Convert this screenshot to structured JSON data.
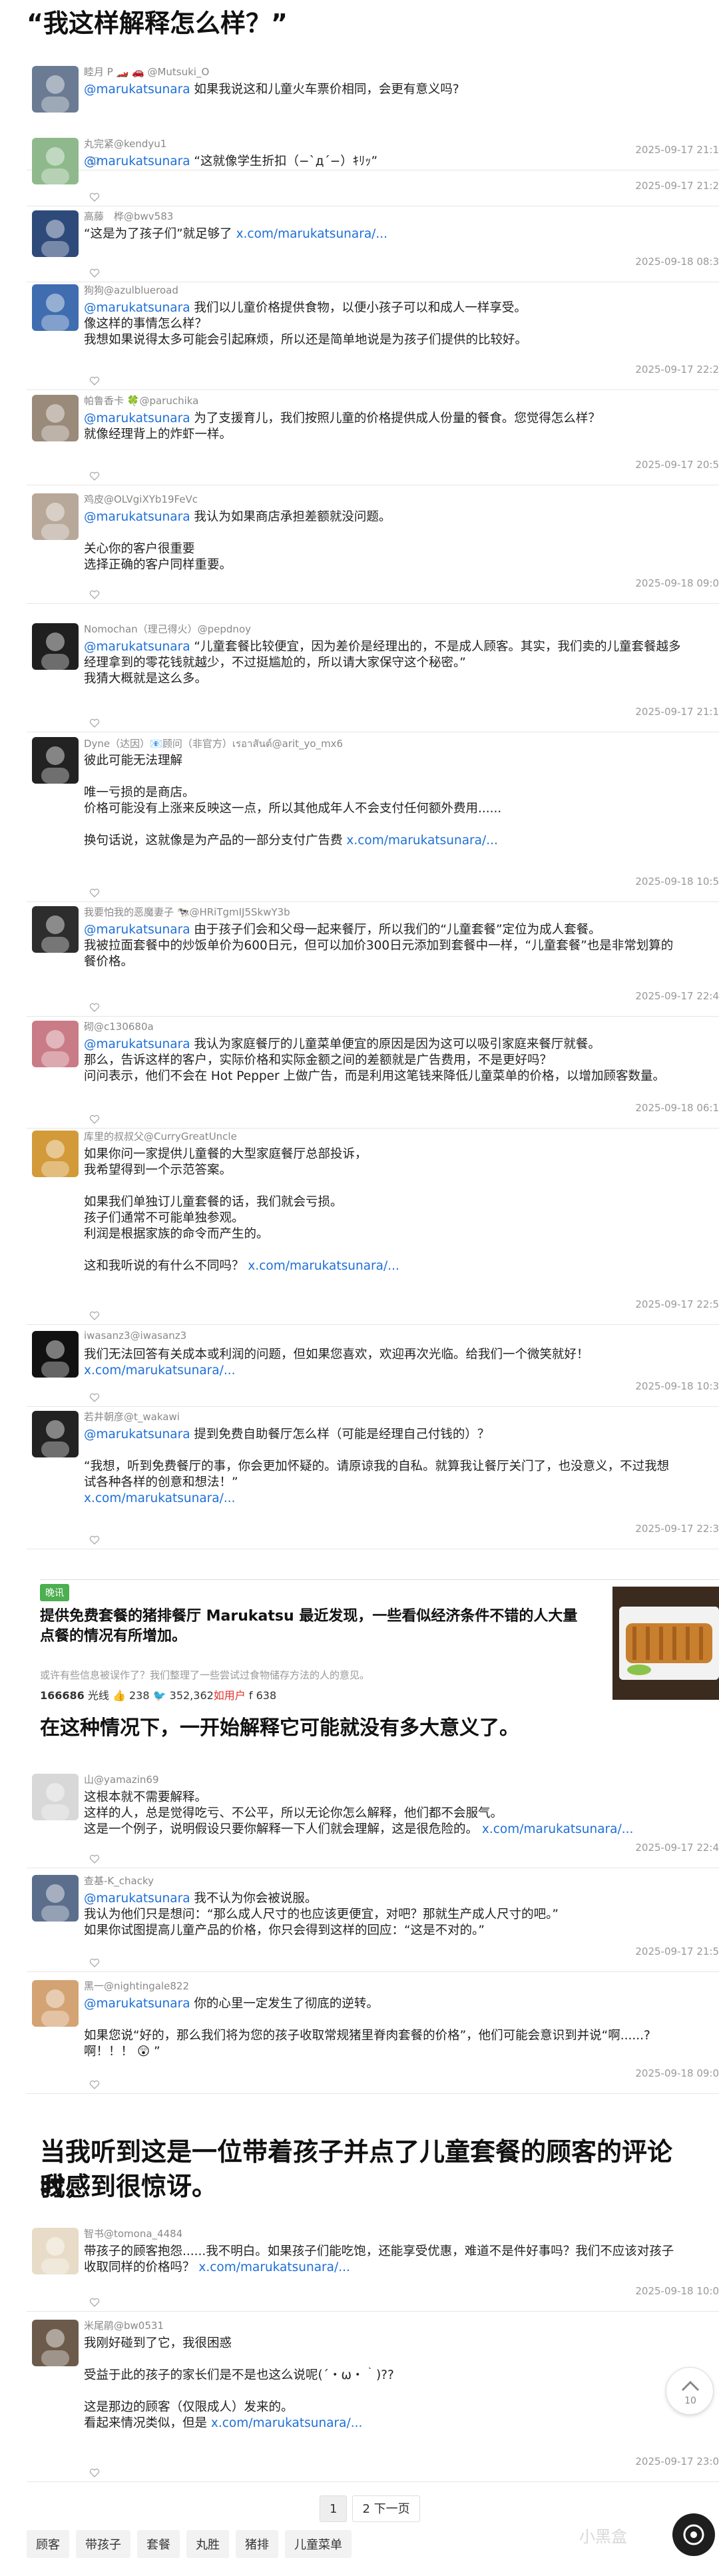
{
  "headline": "“我这样解释怎么样？”",
  "tweets": [
    {
      "handle": "睦月 P 🏎️ 🚗 @Mutsuki_O",
      "lines": [
        [
          "@marukatsunara",
          " 如果我说这和儿童火车票价相同，会更有意义吗?"
        ]
      ],
      "date": "2025-09-17 21:1"
    },
    {
      "handle": "丸完紧@kendyu1",
      "lines": [
        [
          "@marukatsunara",
          " “这就像学生折扣（−`д´−）ｷﾘｯ”"
        ]
      ],
      "date": "2025-09-17 21:2"
    },
    {
      "handle": "高藤　桦@bwv583",
      "lines": [
        [
          "",
          "“这是为了孩子们”就足够了 ",
          "x.com/marukatsunara/..."
        ]
      ],
      "date": "2025-09-18 08:3"
    },
    {
      "handle": "狗狗@azulblueroad",
      "lines": [
        [
          "@marukatsunara",
          " 我们以儿童价格提供食物，以便小孩子可以和成人一样享受。"
        ],
        [
          "",
          "像这样的事情怎么样？"
        ],
        [
          "",
          "我想如果说得太多可能会引起麻烦，所以还是简单地说是为孩子们提供的比较好。"
        ]
      ],
      "date": "2025-09-17 22:2"
    },
    {
      "handle": "帕鲁香卡 🍀@paruchika",
      "lines": [
        [
          "@marukatsunara",
          " 为了支援育儿，我们按照儿童的价格提供成人份量的餐食。您觉得怎么样？"
        ],
        [
          "",
          "就像经理背上的炸虾一样。"
        ]
      ],
      "date": "2025-09-17 20:5"
    },
    {
      "handle": "鸡皮@OLVgiXYb19FeVc",
      "lines": [
        [
          "@marukatsunara",
          " 我认为如果商店承担差额就没问题。"
        ],
        [
          "",
          ""
        ],
        [
          "",
          "关心你的客户很重要"
        ],
        [
          "",
          "选择正确的客户同样重要。"
        ]
      ],
      "date": "2025-09-18 09:0"
    },
    {
      "handle": "Nomochan（理己得火）@pepdnoy",
      "lines": [
        [
          "@marukatsunara",
          " “儿童套餐比较便宜，因为差价是经理出的，不是成人顾客。其实，我们卖的儿童套餐越多"
        ],
        [
          "",
          "经理拿到的零花钱就越少，不过挺尴尬的，所以请大家保守这个秘密。”"
        ],
        [
          "",
          "我猜大概就是这么多。"
        ]
      ],
      "date": "2025-09-17 21:1"
    },
    {
      "handle": "Dyne（达因）📧顾问（非官方）เรอาสันต์@arit_yo_mx6",
      "lines": [
        [
          "",
          "彼此可能无法理解"
        ],
        [
          "",
          ""
        ],
        [
          "",
          "唯一亏损的是商店。"
        ],
        [
          "",
          "价格可能没有上涨来反映这一点，所以其他成年人不会支付任何额外费用......"
        ],
        [
          "",
          ""
        ],
        [
          "",
          "换句话说，这就像是为产品的一部分支付广告费 ",
          "x.com/marukatsunara/..."
        ]
      ],
      "date": "2025-09-18 10:5"
    },
    {
      "handle": "我要怕我的恶魔妻子 🐄@HRiTgmIJ5SkwY3b",
      "lines": [
        [
          "@marukatsunara",
          " 由于孩子们会和父母一起来餐厅，所以我们的“儿童套餐”定位为成人套餐。"
        ],
        [
          "",
          "我被拉面套餐中的炒饭单价为600日元，但可以加价300日元添加到套餐中一样，“儿童套餐”也是非常划算的"
        ],
        [
          "",
          "餐价格。"
        ]
      ],
      "date": "2025-09-17 22:4"
    },
    {
      "handle": "砌@c130680a",
      "lines": [
        [
          "@marukatsunara",
          " 我认为家庭餐厅的儿童菜单便宜的原因是因为这可以吸引家庭来餐厅就餐。"
        ],
        [
          "",
          "那么，告诉这样的客户，实际价格和实际金额之间的差额就是广告费用，不是更好吗？"
        ],
        [
          "",
          "问问表示，他们不会在 Hot Pepper 上做广告，而是利用这笔钱来降低儿童菜单的价格，以增加顾客数量。"
        ]
      ],
      "date": "2025-09-18 06:1"
    },
    {
      "handle": "库里的叔叔父@CurryGreatUncle",
      "lines": [
        [
          "",
          "如果你问一家提供儿童餐的大型家庭餐厅总部投诉，"
        ],
        [
          "",
          "我希望得到一个示范答案。"
        ],
        [
          "",
          ""
        ],
        [
          "",
          "如果我们单独订儿童套餐的话，我们就会亏损。"
        ],
        [
          "",
          "孩子们通常不可能单独参观。"
        ],
        [
          "",
          "利润是根据家族的命令而产生的。"
        ],
        [
          "",
          ""
        ],
        [
          "",
          "这和我听说的有什么不同吗？ ",
          "x.com/marukatsunara/..."
        ]
      ],
      "date": "2025-09-17 22:5"
    },
    {
      "handle": "iwasanz3@iwasanz3",
      "lines": [
        [
          "",
          "我们无法回答有关成本或利润的问题，但如果您喜欢，欢迎再次光临。给我们一个微笑就好！"
        ],
        [
          "",
          "",
          "x.com/marukatsunara/..."
        ]
      ],
      "date": "2025-09-18 10:3"
    },
    {
      "handle": "若井朝彦@t_wakawi",
      "lines": [
        [
          "@marukatsunara",
          " 提到免费自助餐厅怎么样（可能是经理自己付钱的）？"
        ],
        [
          "",
          ""
        ],
        [
          "",
          "“我想，听到免费餐厅的事，你会更加怀疑的。请原谅我的自私。就算我让餐厅关门了，也没意义，不过我想"
        ],
        [
          "",
          "试各种各样的创意和想法！”"
        ],
        [
          "",
          "",
          "x.com/marukatsunara/..."
        ]
      ],
      "date": "2025-09-17 22:3"
    }
  ],
  "card": {
    "badge": "晚讯",
    "title": "提供免费套餐的猪排餐厅 Marukatsu 最近发现，一些看似经济条件不错的人大量点餐的情况有所增加。",
    "subtitle": "或许有些信息被误作了？我们整理了一些尝试过食物储存方法的人的意见。",
    "stats_count": "166686",
    "stats_label": " 光线 ",
    "stats_likes": "👍 238  ",
    "stats_retweets": "🐦 352,362",
    "stats_red": "如用户",
    "stats_fb": " f 638"
  },
  "section1": "在这种情况下，一开始解释它可能就没有多大意义了。",
  "tweets2": [
    {
      "handle": "山@yamazin69",
      "lines": [
        [
          "",
          "这根本就不需要解释。"
        ],
        [
          "",
          "这样的人，总是觉得吃亏、不公平，所以无论你怎么解释，他们都不会服气。"
        ],
        [
          "",
          "这是一个例子，说明假设只要你解释一下人们就会理解，这是很危险的。 ",
          "x.com/marukatsunara/..."
        ]
      ],
      "date": "2025-09-17 22:4"
    },
    {
      "handle": "查基-K_chacky",
      "lines": [
        [
          "@marukatsunara",
          " 我不认为你会被说服。"
        ],
        [
          "",
          "我认为他们只是想问：“那么成人尺寸的也应该更便宜，对吧？那就生产成人尺寸的吧。”"
        ],
        [
          "",
          "如果你试图提高儿童产品的价格，你只会得到这样的回应：“这是不对的。”"
        ]
      ],
      "date": "2025-09-17 21:5"
    },
    {
      "handle": "黑一@nightingale822",
      "lines": [
        [
          "@marukatsunara",
          " 你的心里一定发生了彻底的逆转。"
        ],
        [
          "",
          ""
        ],
        [
          "",
          "如果您说“好的，那么我们将为您的孩子收取常规猪里脊肉套餐的价格”，他们可能会意识到并说“啊......?"
        ],
        [
          "",
          "啊！！！ 😲 ”"
        ]
      ],
      "date": "2025-09-18 09:0"
    }
  ],
  "section2_line1": "当我听到这是一位带着孩子并点了儿童套餐的顾客的评论时，",
  "section2_line2": "我感到很惊讶。",
  "tweets3": [
    {
      "handle": "智书@tomona_4484",
      "lines": [
        [
          "",
          "带孩子的顾客抱怨......我不明白。如果孩子们能吃饱，还能享受优惠，难道不是件好事吗？我们不应该对孩子"
        ],
        [
          "",
          "收取同样的价格吗？ ",
          "x.com/marukatsunara/..."
        ]
      ],
      "date": "2025-09-18 10:0"
    },
    {
      "handle": "米尾鹃@bw0531",
      "lines": [
        [
          "",
          "我刚好碰到了它，我很困惑"
        ],
        [
          "",
          ""
        ],
        [
          "",
          "受益于此的孩子的家长们是不是也这么说呢(´・ω・｀)??"
        ],
        [
          "",
          ""
        ],
        [
          "",
          "这是那边的顾客（仅限成人）发来的。"
        ],
        [
          "",
          "看起来情况类似，但是 ",
          "x.com/marukatsunara/..."
        ]
      ],
      "date": "2025-09-17 23:0"
    }
  ],
  "pager": {
    "current": "1",
    "next": "2 下一页"
  },
  "tags": [
    "顾客",
    "带孩子",
    "套餐",
    "丸胜",
    "猪排",
    "儿童菜单"
  ],
  "watermark": "小黑盒",
  "scroll_label": "10"
}
